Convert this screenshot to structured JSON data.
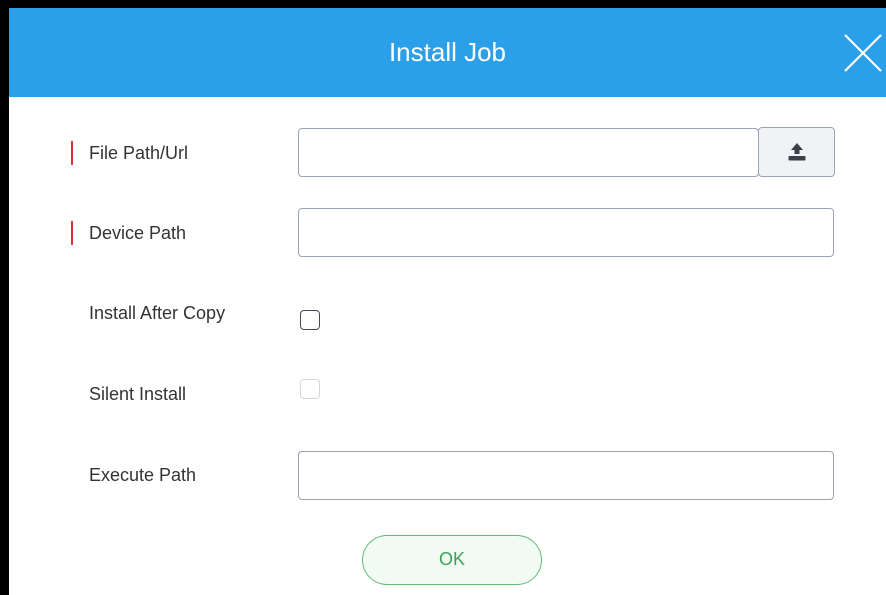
{
  "dialog": {
    "title": "Install Job",
    "close_icon": "close-icon",
    "header_color": "#2b9fe8"
  },
  "form": {
    "file_path": {
      "label": "File Path/Url",
      "required": true,
      "value": "",
      "upload_icon": "upload-icon"
    },
    "device_path": {
      "label": "Device Path",
      "required": true,
      "value": ""
    },
    "install_after_copy": {
      "label": "Install After Copy",
      "checked": false,
      "enabled": true
    },
    "silent_install": {
      "label": "Silent Install",
      "checked": false,
      "enabled": false
    },
    "execute_path": {
      "label": "Execute Path",
      "value": ""
    }
  },
  "actions": {
    "ok_label": "OK",
    "ok_color": "#3ca356"
  }
}
